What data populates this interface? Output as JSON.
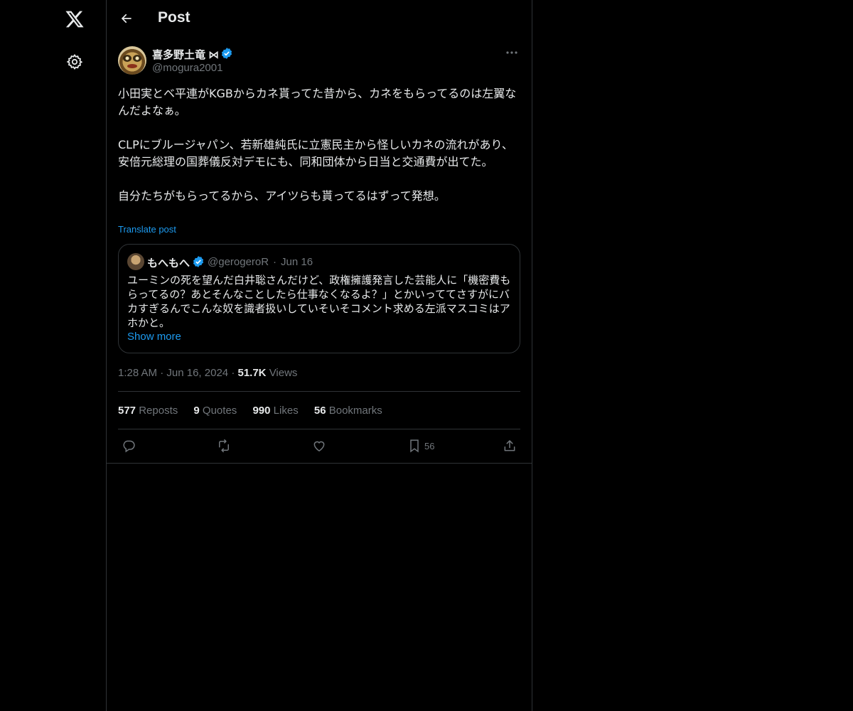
{
  "header": {
    "title": "Post"
  },
  "post": {
    "author_name": "喜多野土竜 ⋈",
    "author_handle": "@mogura2001",
    "text": "小田実とベ平連がKGBからカネ貰ってた昔から、カネをもらってるのは左翼なんだよなぁ。\n\nCLPにブルージャパン、若新雄純氏に立憲民主から怪しいカネの流れがあり、安倍元総理の国葬儀反対デモにも、同和団体から日当と交通費が出てた。\n\n自分たちがもらってるから、アイツらも貰ってるはずって発想。",
    "translate_label": "Translate post",
    "time": "1:28 AM",
    "date": "Jun 16, 2024",
    "views_count": "51.7K",
    "views_label": "Views"
  },
  "quote": {
    "author_name": "もへもへ",
    "author_handle": "@gerogeroR",
    "separator": "·",
    "date": "Jun 16",
    "text": "ユーミンの死を望んだ白井聡さんだけど、政権擁護発言した芸能人に「機密費もらってるの？あとそんなことしたら仕事なくなるよ？」とかいっててさすがにバカすぎるんでこんな奴を識者扱いしていそいそコメント求める左派マスコミはアホかと。",
    "show_more": "Show more"
  },
  "stats": {
    "reposts": {
      "count": "577",
      "label": "Reposts"
    },
    "quotes": {
      "count": "9",
      "label": "Quotes"
    },
    "likes": {
      "count": "990",
      "label": "Likes"
    },
    "bookmarks": {
      "count": "56",
      "label": "Bookmarks"
    }
  },
  "actions": {
    "bookmark_count": "56"
  },
  "meta_sep": "·",
  "colors": {
    "background": "#000000",
    "accent": "#1d9bf0",
    "muted": "#71767b",
    "border": "#2f3336"
  },
  "icons": [
    "x-logo-icon",
    "gear-icon",
    "back-arrow-icon",
    "verified-icon",
    "more-icon",
    "reply-icon",
    "repost-icon",
    "like-icon",
    "bookmark-icon",
    "share-icon"
  ]
}
